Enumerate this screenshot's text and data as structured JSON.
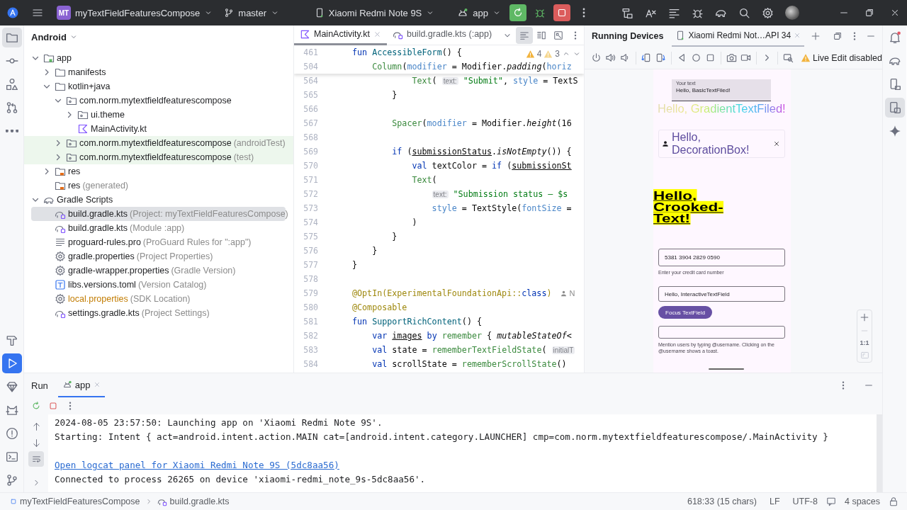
{
  "top_bar": {
    "project_badge": "MT",
    "project": "myTextFieldFeaturesCompose",
    "branch": "master",
    "device": "Xiaomi Redmi Note 9S",
    "run_config": "app"
  },
  "stripes": {
    "left_top": [
      {
        "kind": "project",
        "selected": true
      },
      {
        "kind": "commit",
        "selected": false
      },
      {
        "kind": "structure",
        "selected": false
      },
      {
        "kind": "pull_requests",
        "selected": false
      },
      {
        "kind": "more",
        "selected": false
      }
    ],
    "left_bottom": [
      {
        "kind": "build",
        "selected": false
      },
      {
        "kind": "run",
        "selected": true
      },
      {
        "kind": "variants",
        "selected": false
      },
      {
        "kind": "logcat",
        "selected": false
      },
      {
        "kind": "problems",
        "selected": false
      },
      {
        "kind": "terminal",
        "selected": false
      },
      {
        "kind": "git",
        "selected": false
      }
    ],
    "right": [
      {
        "kind": "notifications",
        "selected": false
      },
      {
        "kind": "gradle",
        "selected": false
      },
      {
        "kind": "device_manager",
        "selected": false
      },
      {
        "kind": "running_devices",
        "selected": true
      },
      {
        "kind": "gemini",
        "selected": false
      }
    ]
  },
  "project": {
    "view": "Android",
    "tree": [
      {
        "label": "app",
        "kind": "module",
        "expanded": true,
        "selected": false,
        "tinted": false,
        "ignored": false,
        "children": [
          {
            "label": "manifests",
            "kind": "folder",
            "expanded": false,
            "selected": false,
            "tinted": false,
            "ignored": false
          },
          {
            "label": "kotlin+java",
            "kind": "folder",
            "expanded": true,
            "selected": false,
            "tinted": false,
            "ignored": false,
            "children": [
              {
                "label": "com.norm.mytextfieldfeaturescompose",
                "kind": "package",
                "expanded": true,
                "selected": false,
                "tinted": false,
                "ignored": false,
                "children": [
                  {
                    "label": "ui.theme",
                    "kind": "package",
                    "expanded": false,
                    "selected": false,
                    "tinted": false,
                    "ignored": false
                  },
                  {
                    "label": "MainActivity.kt",
                    "kind": "kotlin",
                    "selected": false,
                    "tinted": false,
                    "ignored": false
                  }
                ]
              },
              {
                "label": "com.norm.mytextfieldfeaturescompose",
                "note": "(androidTest)",
                "kind": "package",
                "expanded": false,
                "selected": false,
                "tinted": true,
                "ignored": false
              },
              {
                "label": "com.norm.mytextfieldfeaturescompose",
                "note": "(test)",
                "kind": "package",
                "expanded": false,
                "selected": false,
                "tinted": true,
                "ignored": false
              }
            ]
          },
          {
            "label": "res",
            "kind": "res",
            "expanded": false,
            "selected": false,
            "tinted": false,
            "ignored": false
          },
          {
            "label": "res",
            "note": "(generated)",
            "kind": "res",
            "selected": false,
            "tinted": false,
            "ignored": false
          }
        ]
      },
      {
        "label": "Gradle Scripts",
        "kind": "gradle",
        "expanded": true,
        "selected": false,
        "tinted": false,
        "ignored": false,
        "children": [
          {
            "label": "build.gradle.kts",
            "note": "(Project: myTextFieldFeaturesCompose)",
            "kind": "gradle_file",
            "selected": true,
            "tinted": false,
            "ignored": false
          },
          {
            "label": "build.gradle.kts",
            "note": "(Module :app)",
            "kind": "gradle_file",
            "selected": false,
            "tinted": false,
            "ignored": false
          },
          {
            "label": "proguard-rules.pro",
            "note": "(ProGuard Rules for \":app\")",
            "kind": "text",
            "selected": false,
            "tinted": false,
            "ignored": false
          },
          {
            "label": "gradle.properties",
            "note": "(Project Properties)",
            "kind": "settings",
            "selected": false,
            "tinted": false,
            "ignored": false
          },
          {
            "label": "gradle-wrapper.properties",
            "note": "(Gradle Version)",
            "kind": "settings",
            "selected": false,
            "tinted": false,
            "ignored": false
          },
          {
            "label": "libs.versions.toml",
            "note": "(Version Catalog)",
            "kind": "toml",
            "selected": false,
            "tinted": false,
            "ignored": false
          },
          {
            "label": "local.properties",
            "note": "(SDK Location)",
            "kind": "settings",
            "selected": false,
            "tinted": false,
            "ignored": true
          },
          {
            "label": "settings.gradle.kts",
            "note": "(Project Settings)",
            "kind": "gradle_file",
            "selected": false,
            "tinted": false,
            "ignored": false
          }
        ]
      }
    ]
  },
  "editor": {
    "tabs": [
      {
        "label": "MainActivity.kt",
        "kind": "kotlin",
        "selected": true
      },
      {
        "label": "build.gradle.kts (:app)",
        "kind": "gradle_file",
        "selected": false
      }
    ],
    "inspections": {
      "warnings": "4",
      "weak_warnings": "3"
    },
    "sticky_lines": [
      {
        "number": "461",
        "tokens": [
          {
            "kind": "keyword",
            "text": "fun"
          },
          {
            "kind": "function",
            "text": " AccessibleForm"
          },
          {
            "kind": "plain",
            "text": "() {"
          }
        ]
      },
      {
        "number": "504",
        "tokens": [
          {
            "kind": "composable",
            "text": "    Column"
          },
          {
            "kind": "plain",
            "text": "("
          },
          {
            "kind": "argument",
            "text": "modifier"
          },
          {
            "kind": "plain",
            "text": " = Modifier."
          },
          {
            "kind": "extension",
            "text": "padding"
          },
          {
            "kind": "plain",
            "text": "("
          },
          {
            "kind": "argument",
            "text": "horiz"
          }
        ]
      }
    ],
    "lines": [
      {
        "number": "564",
        "tokens": [
          {
            "kind": "composable",
            "text": "            Text"
          },
          {
            "kind": "plain",
            "text": "( "
          },
          {
            "kind": "hint",
            "text": "text:"
          },
          {
            "kind": "string",
            "text": " \"Submit\""
          },
          {
            "kind": "plain",
            "text": ", "
          },
          {
            "kind": "argument",
            "text": "style"
          },
          {
            "kind": "plain",
            "text": " = TextS"
          }
        ]
      },
      {
        "number": "565",
        "tokens": [
          {
            "kind": "plain",
            "text": "        }"
          }
        ]
      },
      {
        "number": "566"
      },
      {
        "number": "567",
        "tokens": [
          {
            "kind": "composable",
            "text": "        Spacer"
          },
          {
            "kind": "plain",
            "text": "("
          },
          {
            "kind": "argument",
            "text": "modifier"
          },
          {
            "kind": "plain",
            "text": " = Modifier."
          },
          {
            "kind": "extension",
            "text": "height"
          },
          {
            "kind": "plain",
            "text": "(16"
          }
        ]
      },
      {
        "number": "568"
      },
      {
        "number": "569",
        "tokens": [
          {
            "kind": "keyword",
            "text": "        if"
          },
          {
            "kind": "plain",
            "text": " ("
          },
          {
            "kind": "reference",
            "text": "submissionStatus"
          },
          {
            "kind": "plain",
            "text": "."
          },
          {
            "kind": "extension",
            "text": "isNotEmpty"
          },
          {
            "kind": "plain",
            "text": "()) {"
          }
        ]
      },
      {
        "number": "570",
        "tokens": [
          {
            "kind": "keyword",
            "text": "            val"
          },
          {
            "kind": "plain",
            "text": " textColor = "
          },
          {
            "kind": "keyword",
            "text": "if"
          },
          {
            "kind": "plain",
            "text": " ("
          },
          {
            "kind": "reference",
            "text": "submissionSt"
          }
        ]
      },
      {
        "number": "571",
        "tokens": [
          {
            "kind": "composable",
            "text": "            Text"
          },
          {
            "kind": "plain",
            "text": "("
          }
        ]
      },
      {
        "number": "572",
        "tokens": [
          {
            "kind": "hint",
            "text": "                text:"
          },
          {
            "kind": "string",
            "text": " \"Submission status — $s"
          }
        ]
      },
      {
        "number": "573",
        "tokens": [
          {
            "kind": "argument",
            "text": "                style"
          },
          {
            "kind": "plain",
            "text": " = TextStyle("
          },
          {
            "kind": "argument",
            "text": "fontSize"
          },
          {
            "kind": "plain",
            "text": " ="
          }
        ]
      },
      {
        "number": "574",
        "tokens": [
          {
            "kind": "plain",
            "text": "            )"
          }
        ]
      },
      {
        "number": "575",
        "tokens": [
          {
            "kind": "plain",
            "text": "        }"
          }
        ]
      },
      {
        "number": "576",
        "tokens": [
          {
            "kind": "plain",
            "text": "    }"
          }
        ]
      },
      {
        "number": "577",
        "tokens": [
          {
            "kind": "plain",
            "text": "}"
          }
        ]
      },
      {
        "number": "578"
      },
      {
        "number": "579",
        "tokens": [
          {
            "kind": "annotation",
            "text": "@OptIn(ExperimentalFoundationApi::"
          },
          {
            "kind": "keyword",
            "text": "class"
          },
          {
            "kind": "annotation",
            "text": ")"
          }
        ],
        "author": "N"
      },
      {
        "number": "580",
        "tokens": [
          {
            "kind": "annotation",
            "text": "@Composable"
          }
        ]
      },
      {
        "number": "581",
        "tokens": [
          {
            "kind": "keyword",
            "text": "fun"
          },
          {
            "kind": "function",
            "text": " SupportRichContent"
          },
          {
            "kind": "plain",
            "text": "() {"
          }
        ]
      },
      {
        "number": "582",
        "tokens": [
          {
            "kind": "keyword",
            "text": "    var"
          },
          {
            "kind": "reference",
            "text": " images"
          },
          {
            "kind": "keyword",
            "text": " by"
          },
          {
            "kind": "composable",
            "text": " remember"
          },
          {
            "kind": "plain",
            "text": " { "
          },
          {
            "kind": "extension",
            "text": "mutableStateOf"
          },
          {
            "kind": "plain",
            "text": "<"
          }
        ]
      },
      {
        "number": "583",
        "tokens": [
          {
            "kind": "keyword",
            "text": "    val"
          },
          {
            "kind": "plain",
            "text": " state = "
          },
          {
            "kind": "composable",
            "text": "rememberTextFieldState"
          },
          {
            "kind": "plain",
            "text": "( "
          },
          {
            "kind": "hint",
            "text": "initialT"
          }
        ]
      },
      {
        "number": "584",
        "tokens": [
          {
            "kind": "keyword",
            "text": "    val"
          },
          {
            "kind": "plain",
            "text": " scrollState = "
          },
          {
            "kind": "composable",
            "text": "rememberScrollState"
          },
          {
            "kind": "plain",
            "text": "()"
          }
        ]
      }
    ]
  },
  "devices": {
    "title": "Running Devices",
    "device_tab": "Xiaomi Redmi Not…API 34",
    "live_edit": "Live Edit disabled",
    "zoom_reset": "1:1",
    "screen": {
      "basic_field": {
        "label": "Your text",
        "value": "Hello, BasicTextFiled!"
      },
      "gradient_text": "Hello, GradientTextFiled!",
      "decoration_box": {
        "value": "Hello, DecorationBox!"
      },
      "crooked_text": "Hello, Crooked-Text!",
      "card_field": {
        "value": "5381 3904 2829 0590",
        "supporting": "Enter your credit card number"
      },
      "interactive_field": {
        "value": "Hello, InteractiveTextField"
      },
      "focus_button": "Focus TextField",
      "mention_field": {
        "supporting": "Mention users by typing @username. Clicking on the @username shows a toast."
      }
    }
  },
  "run": {
    "title": "Run",
    "tabs": [
      {
        "label": "app",
        "selected": true
      }
    ],
    "gutter": [
      {
        "kind": "up",
        "selected": false
      },
      {
        "kind": "down",
        "selected": false
      },
      {
        "kind": "wrap",
        "selected": true
      },
      {
        "kind": "expand",
        "selected": false
      }
    ],
    "console": [
      {
        "kind": "plain",
        "text": "2024-08-05 23:57:50: Launching app on 'Xiaomi Redmi Note 9S'."
      },
      {
        "kind": "plain",
        "text": "Starting: Intent { act=android.intent.action.MAIN cat=[android.intent.category.LAUNCHER] cmp=com.norm.mytextfieldfeaturescompose/.MainActivity }"
      },
      {
        "kind": "gap"
      },
      {
        "kind": "link",
        "text": "Open logcat panel for Xiaomi Redmi Note 9S (5dc8aa56)"
      },
      {
        "kind": "plain",
        "text": "Connected to process 26265 on device 'xiaomi-redmi_note_9s-5dc8aa56'."
      }
    ]
  },
  "status_bar": {
    "breadcrumbs": [
      {
        "kind": "module",
        "label": "myTextFieldFeaturesCompose"
      },
      {
        "kind": "gradle_file",
        "label": "build.gradle.kts"
      }
    ],
    "position": "618:33 (15 chars)",
    "line_separator": "LF",
    "encoding": "UTF-8",
    "indent": "4 spaces"
  }
}
